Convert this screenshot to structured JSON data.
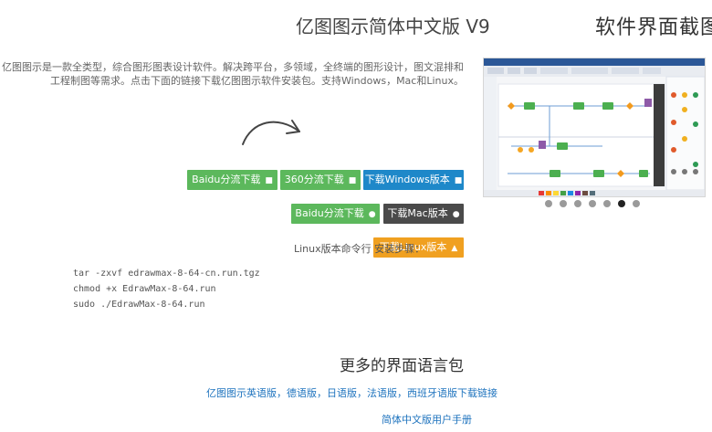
{
  "right": {
    "title": "软件界面截图",
    "carousel": {
      "dot_count": 7,
      "active_index": 5
    }
  },
  "main": {
    "title": "亿图图示简体中文版 V9",
    "description": "亿图图示是一款全类型，综合图形图表设计软件。解决跨平台，多领域，全终端的图形设计，图文混排和工程制图等需求。点击下面的链接下载亿图图示软件安装包。支持Windows，Mac和Linux。"
  },
  "downloads": {
    "windows_label": "下载Windows版本",
    "windows_360_label": "360分流下载",
    "windows_baidu_label": "Baidu分流下载",
    "mac_label": "下载Mac版本",
    "mac_baidu_label": "Baidu分流下载",
    "linux_label": "下载Linux版本"
  },
  "linux": {
    "hint": "Linux版本命令行 安装步骤：",
    "commands": [
      "tar -zxvf edrawmax-8-64-cn.run.tgz",
      "chmod +x EdrawMax-8-64.run",
      "sudo ./EdrawMax-8-64.run"
    ]
  },
  "more": {
    "title": "更多的界面语言包",
    "languages_link": "亿图图示英语版，德语版，日语版，法语版，西班牙语版下载链接",
    "manual_link": "简体中文版用户手册"
  },
  "colors": {
    "green": "#5cb85c",
    "blue": "#1e88c9",
    "dark": "#4a4a4a",
    "orange": "#f0a020",
    "link": "#1e73be"
  }
}
